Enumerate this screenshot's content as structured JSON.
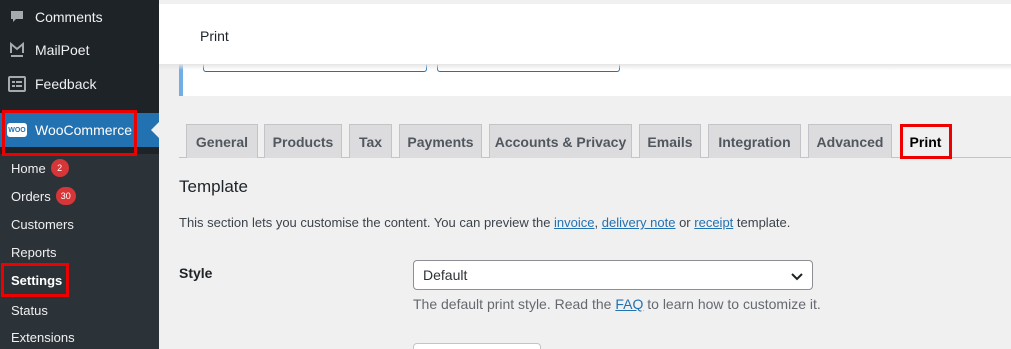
{
  "sidebar": {
    "items": [
      {
        "label": "Comments",
        "icon": "comment-icon"
      },
      {
        "label": "MailPoet",
        "icon": "mailpoet-icon"
      },
      {
        "label": "Feedback",
        "icon": "feedback-icon"
      },
      {
        "label": "WooCommerce",
        "icon": "woocommerce-icon",
        "logo_text": "WOO"
      }
    ],
    "submenu": [
      {
        "label": "Home",
        "count": "2"
      },
      {
        "label": "Orders",
        "count": "30"
      },
      {
        "label": "Customers"
      },
      {
        "label": "Reports"
      },
      {
        "label": "Settings"
      },
      {
        "label": "Status"
      },
      {
        "label": "Extensions"
      }
    ]
  },
  "header": {
    "title": "Print"
  },
  "tabs": [
    "General",
    "Products",
    "Tax",
    "Payments",
    "Accounts & Privacy",
    "Emails",
    "Integration",
    "Advanced",
    "Print"
  ],
  "active_tab": "Print",
  "section": {
    "title": "Template",
    "desc_prefix": "This section lets you customise the content. You can preview the ",
    "link_invoice": "invoice",
    "sep1": ", ",
    "link_delivery": "delivery note",
    "sep2": " or ",
    "link_receipt": "receipt",
    "desc_suffix": " template."
  },
  "style_field": {
    "label": "Style",
    "value": "Default",
    "help_prefix": "The default print style. Read the ",
    "help_link": "FAQ",
    "help_suffix": " to learn how to customize it."
  },
  "colors": {
    "accent": "#2271b1",
    "sidebar": "#1d2327",
    "highlight": "#ee0000",
    "badge": "#d63638"
  }
}
